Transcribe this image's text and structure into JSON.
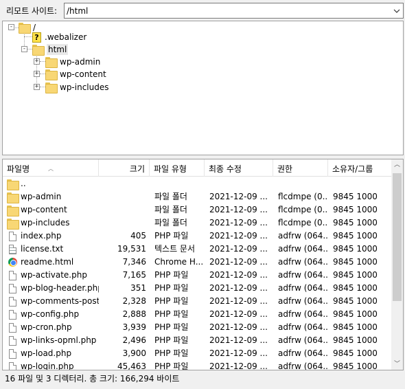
{
  "pathbar": {
    "label": "리모트 사이트:",
    "value": "/html"
  },
  "tree": {
    "nodes": [
      {
        "label": "/",
        "toggle": "-",
        "kind": "folder"
      },
      {
        "label": ".webalizer",
        "toggle": "",
        "kind": "unknown"
      },
      {
        "label": "html",
        "toggle": "-",
        "kind": "folder"
      },
      {
        "label": "wp-admin",
        "toggle": "+",
        "kind": "folder"
      },
      {
        "label": "wp-content",
        "toggle": "+",
        "kind": "folder"
      },
      {
        "label": "wp-includes",
        "toggle": "+",
        "kind": "folder"
      }
    ]
  },
  "columns": [
    "파일명",
    "크기",
    "파일 유형",
    "최종 수정",
    "권한",
    "소유자/그룹"
  ],
  "files": [
    {
      "name": "..",
      "size": "",
      "type": "",
      "modified": "",
      "perm": "",
      "owner": "",
      "icon": "folder"
    },
    {
      "name": "wp-admin",
      "size": "",
      "type": "파일 폴더",
      "modified": "2021-12-09 ...",
      "perm": "flcdmpe (0...",
      "owner": "9845 1000",
      "icon": "folder"
    },
    {
      "name": "wp-content",
      "size": "",
      "type": "파일 폴더",
      "modified": "2021-12-09 ...",
      "perm": "flcdmpe (0...",
      "owner": "9845 1000",
      "icon": "folder"
    },
    {
      "name": "wp-includes",
      "size": "",
      "type": "파일 폴더",
      "modified": "2021-12-09 ...",
      "perm": "flcdmpe (0...",
      "owner": "9845 1000",
      "icon": "folder"
    },
    {
      "name": "index.php",
      "size": "405",
      "type": "PHP 파일",
      "modified": "2021-12-09 ...",
      "perm": "adfrw (064...",
      "owner": "9845 1000",
      "icon": "file"
    },
    {
      "name": "license.txt",
      "size": "19,531",
      "type": "텍스트 문서",
      "modified": "2021-12-09 ...",
      "perm": "adfrw (064...",
      "owner": "9845 1000",
      "icon": "text"
    },
    {
      "name": "readme.html",
      "size": "7,346",
      "type": "Chrome H...",
      "modified": "2021-12-09 ...",
      "perm": "adfrw (064...",
      "owner": "9845 1000",
      "icon": "chrome"
    },
    {
      "name": "wp-activate.php",
      "size": "7,165",
      "type": "PHP 파일",
      "modified": "2021-12-09 ...",
      "perm": "adfrw (064...",
      "owner": "9845 1000",
      "icon": "file"
    },
    {
      "name": "wp-blog-header.php",
      "size": "351",
      "type": "PHP 파일",
      "modified": "2021-12-09 ...",
      "perm": "adfrw (064...",
      "owner": "9845 1000",
      "icon": "file"
    },
    {
      "name": "wp-comments-post...",
      "size": "2,328",
      "type": "PHP 파일",
      "modified": "2021-12-09 ...",
      "perm": "adfrw (064...",
      "owner": "9845 1000",
      "icon": "file"
    },
    {
      "name": "wp-config.php",
      "size": "2,888",
      "type": "PHP 파일",
      "modified": "2021-12-09 ...",
      "perm": "adfrw (064...",
      "owner": "9845 1000",
      "icon": "file"
    },
    {
      "name": "wp-cron.php",
      "size": "3,939",
      "type": "PHP 파일",
      "modified": "2021-12-09 ...",
      "perm": "adfrw (064...",
      "owner": "9845 1000",
      "icon": "file"
    },
    {
      "name": "wp-links-opml.php",
      "size": "2,496",
      "type": "PHP 파일",
      "modified": "2021-12-09 ...",
      "perm": "adfrw (064...",
      "owner": "9845 1000",
      "icon": "file"
    },
    {
      "name": "wp-load.php",
      "size": "3,900",
      "type": "PHP 파일",
      "modified": "2021-12-09 ...",
      "perm": "adfrw (064...",
      "owner": "9845 1000",
      "icon": "file"
    },
    {
      "name": "wp-login.php",
      "size": "45,463",
      "type": "PHP 파일",
      "modified": "2021-12-09 ...",
      "perm": "adfrw (064...",
      "owner": "9845 1000",
      "icon": "file"
    }
  ],
  "status": "16 파일 및 3 디렉터리. 총 크기: 166,294 바이트"
}
